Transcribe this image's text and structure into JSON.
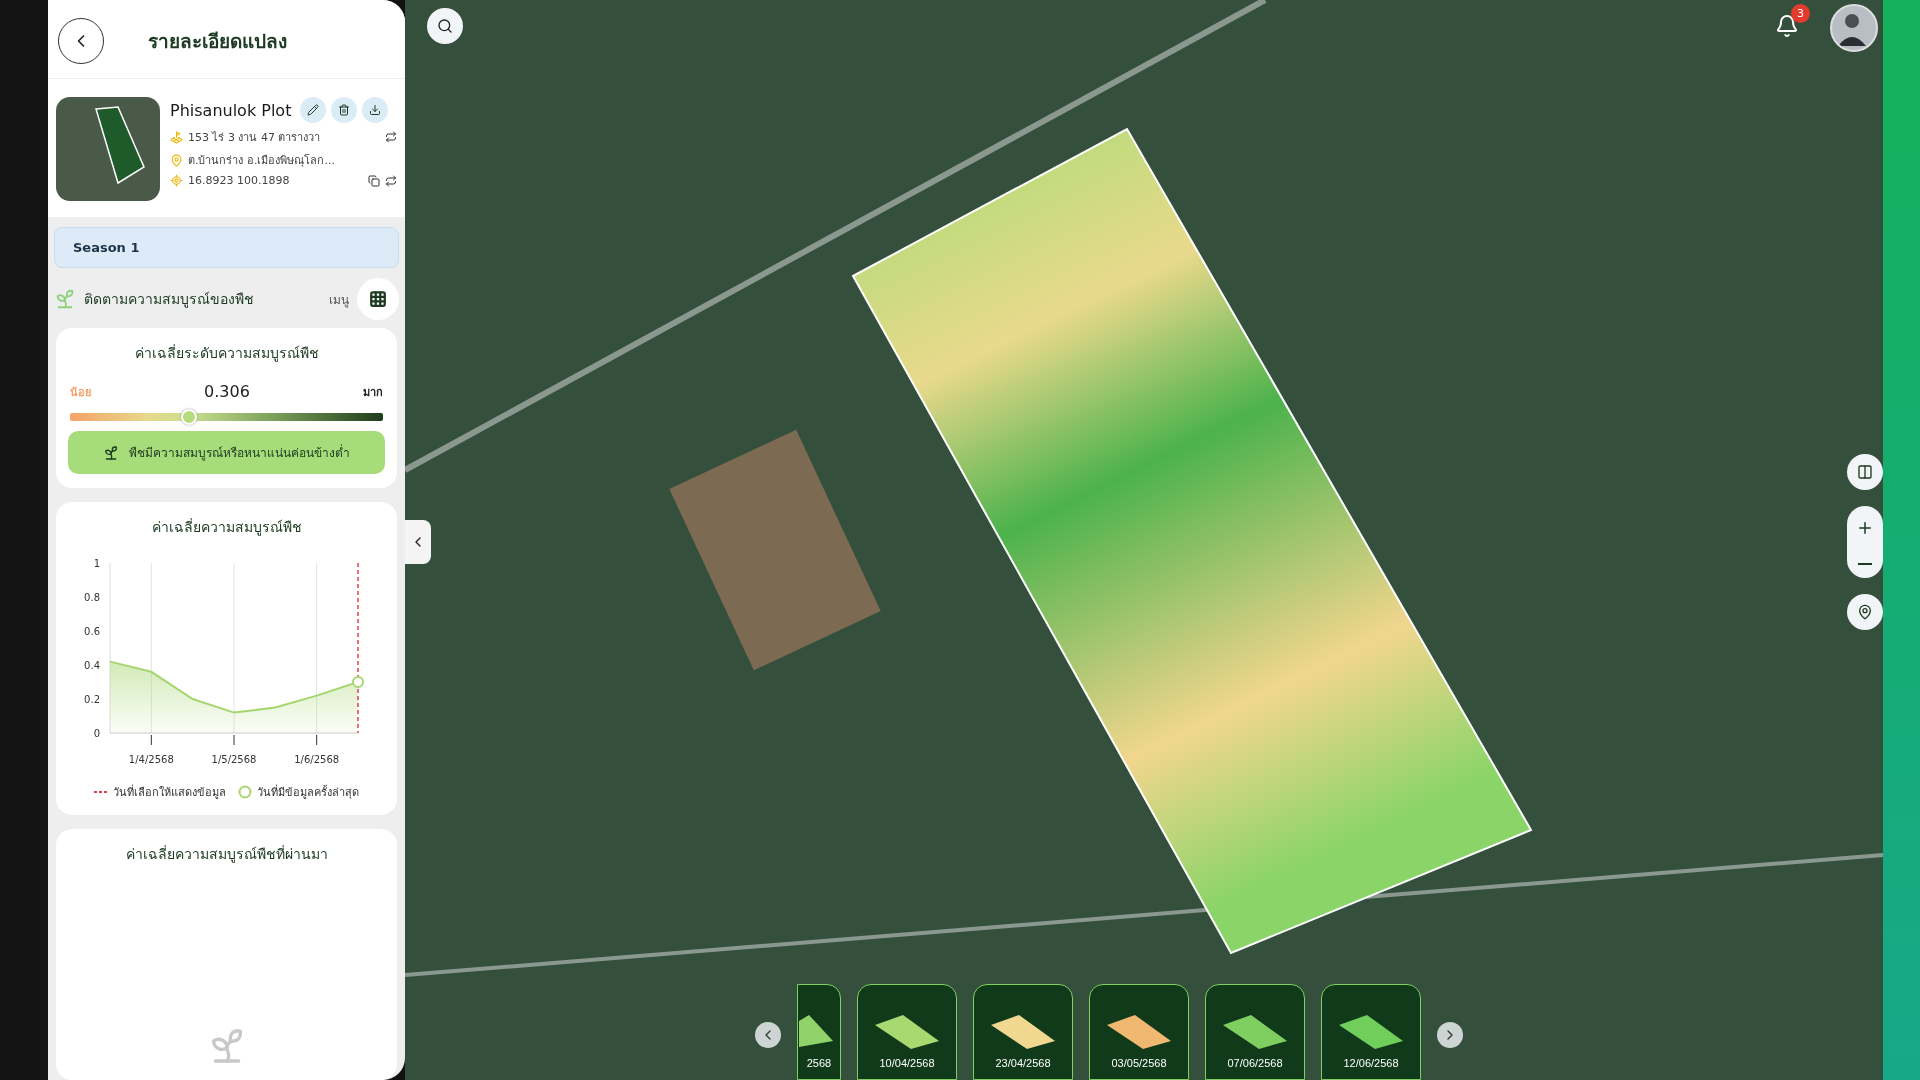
{
  "header": {
    "title": "รายละเอียดแปลง"
  },
  "plot": {
    "name": "Phisanulok Plot",
    "area": "153 ไร่ 3 งาน 47 ตารางวา",
    "location": "ต.บ้านกร่าง อ.เมืองพิษณุโลก...",
    "coordinates": "16.8923 100.1898"
  },
  "season": {
    "label": "Season 1"
  },
  "monitor": {
    "title": "ติดตามความสมบูรณ์ของพืช",
    "menu_label": "เมนู"
  },
  "health_card": {
    "title": "ค่าเฉลี่ยระดับความสมบูรณ์พืช",
    "low_label": "น้อย",
    "value": "0.306",
    "high_label": "มาก",
    "level": 0.38,
    "message": "พืชมีความสมบูรณ์หรือหนาแน่นค่อนข้างต่ำ"
  },
  "trend_card": {
    "title": "ค่าเฉลี่ยความสมบูรณ์พืช",
    "chart_data": {
      "type": "area",
      "categories": [
        null,
        "1/4/2568",
        null,
        "1/5/2568",
        null,
        "1/6/2568",
        null
      ],
      "values": [
        0.42,
        0.36,
        0.2,
        0.12,
        0.15,
        0.22,
        0.3
      ],
      "grid": true,
      "ylim": [
        0,
        1
      ],
      "yticks": [
        0,
        0.2,
        0.4,
        0.6,
        0.8,
        1
      ]
    },
    "legend": [
      {
        "kind": "dashed-line",
        "label": "วันที่เลือกให้แสดงข้อมูล"
      },
      {
        "kind": "ring",
        "label": "วันที่มีข้อมูลครั้งล่าสุด"
      }
    ]
  },
  "history_card": {
    "title": "ค่าเฉลี่ยความสมบูรณ์พืชที่ผ่านมา"
  },
  "notifications": {
    "count": "3"
  },
  "timeline": [
    {
      "label": "2568",
      "kind": "partial",
      "color": "#8fd36a"
    },
    {
      "label": "10/04/2568",
      "kind": "full",
      "color": "#a8d870"
    },
    {
      "label": "23/04/2568",
      "kind": "full",
      "color": "#f0d890"
    },
    {
      "label": "03/05/2568",
      "kind": "full",
      "color": "#f0b870"
    },
    {
      "label": "07/06/2568",
      "kind": "full",
      "color": "#7fcf60"
    },
    {
      "label": "12/06/2568",
      "kind": "full",
      "color": "#6fcf5a"
    }
  ]
}
